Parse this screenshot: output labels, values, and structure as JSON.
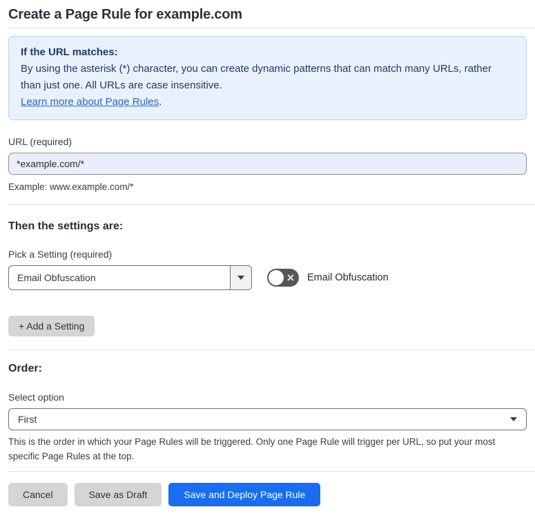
{
  "page": {
    "title": "Create a Page Rule for example.com"
  },
  "info_box": {
    "heading": "If the URL matches:",
    "body": "By using the asterisk (*) character, you can create dynamic patterns that can match many URLs, rather than just one. All URLs are case insensitive.",
    "link_label": "Learn more about Page Rules",
    "link_suffix": "."
  },
  "url_field": {
    "label": "URL (required)",
    "value": "*example.com/*",
    "helper": "Example: www.example.com/*"
  },
  "settings_section": {
    "heading": "Then the settings are:",
    "picker_label": "Pick a Setting (required)",
    "picker_value": "Email Obfuscation",
    "toggle_label": "Email Obfuscation",
    "toggle_state": "off",
    "add_setting_label": "+ Add a Setting"
  },
  "order_section": {
    "heading": "Order:",
    "select_label": "Select option",
    "select_value": "First",
    "helper": "This is the order in which your Page Rules will be triggered. Only one Page Rule will trigger per URL, so put your most specific Page Rules at the top."
  },
  "footer": {
    "cancel_label": "Cancel",
    "save_draft_label": "Save as Draft",
    "save_deploy_label": "Save and Deploy Page Rule"
  },
  "colors": {
    "accent_blue": "#186df0",
    "info_box_bg": "#e9f2fc",
    "info_box_border": "#b4d3f0",
    "info_text": "#1d3a66",
    "link_blue": "#2a64c6",
    "input_autofill_bg": "#e8eefb",
    "toggle_off_bg": "#55575a",
    "gray_button_bg": "#d5d5d5"
  }
}
